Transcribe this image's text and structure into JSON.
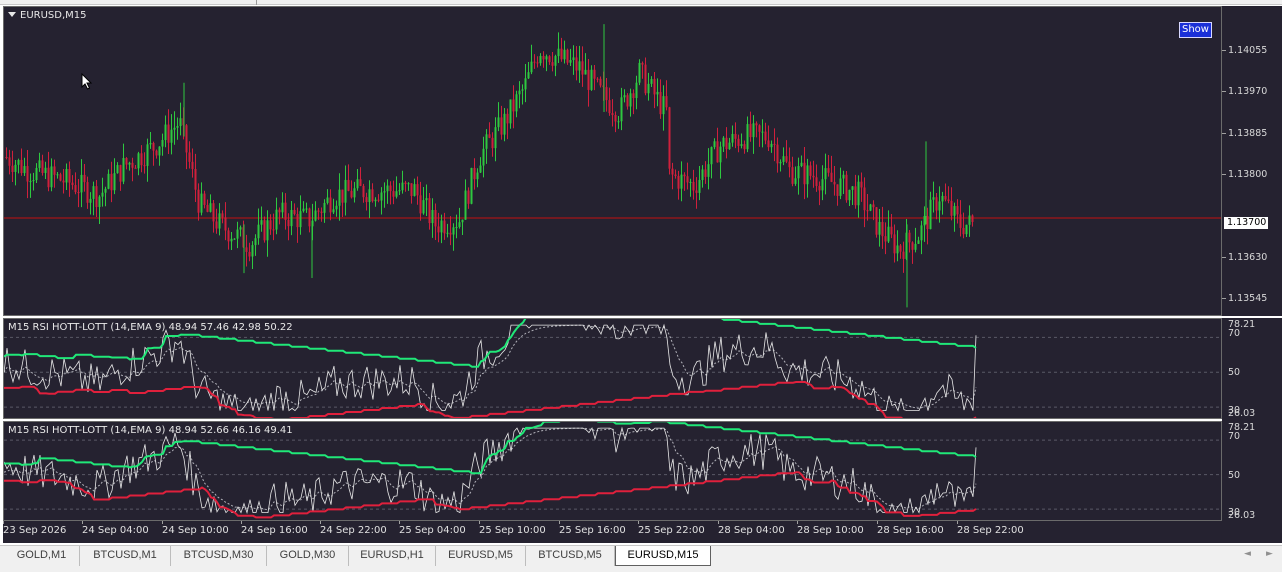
{
  "main_chart": {
    "symbol_title": "EURUSD,M15",
    "show_button": "Show",
    "price_labels": [
      "1.14055",
      "1.13970",
      "1.13885",
      "1.13800",
      "1.13630",
      "1.13545"
    ],
    "current_price": "1.13700",
    "colors": {
      "background": "#252230",
      "bull": "#2ec840",
      "bear": "#d0203c",
      "price_line": "#c41010"
    }
  },
  "indicator_1": {
    "title": "M15 RSI HOTT-LOTT (14,EMA 9) 48.94 57.46 42.98 50.22",
    "levels": [
      "78.21",
      "70",
      "50",
      "30",
      "26.03"
    ]
  },
  "indicator_2": {
    "title": "M15 RSI HOTT-LOTT (14,EMA 9) 48.94 52.66 46.16 49.41",
    "levels": [
      "78.21",
      "70",
      "50",
      "30",
      "26.03"
    ]
  },
  "time_axis": {
    "labels": [
      "23 Sep 2026",
      "24 Sep 04:00",
      "24 Sep 10:00",
      "24 Sep 16:00",
      "24 Sep 22:00",
      "25 Sep 04:00",
      "25 Sep 10:00",
      "25 Sep 16:00",
      "25 Sep 22:00",
      "28 Sep 04:00",
      "28 Sep 10:00",
      "28 Sep 16:00",
      "28 Sep 22:00"
    ]
  },
  "tabs": [
    {
      "label": "GOLD,M1",
      "active": false
    },
    {
      "label": "BTCUSD,M1",
      "active": false
    },
    {
      "label": "BTCUSD,M30",
      "active": false
    },
    {
      "label": "GOLD,M30",
      "active": false
    },
    {
      "label": "EURUSD,H1",
      "active": false
    },
    {
      "label": "EURUSD,M5",
      "active": false
    },
    {
      "label": "BTCUSD,M5",
      "active": false
    },
    {
      "label": "EURUSD,M15",
      "active": true
    }
  ],
  "tab_scroll": {
    "left_icon": "arrow-left-icon",
    "right_icon": "arrow-right-icon"
  }
}
